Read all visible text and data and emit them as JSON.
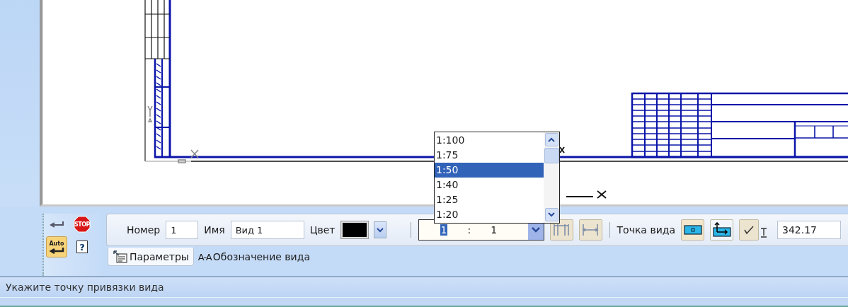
{
  "commands": {
    "stop_label": "STOP",
    "auto_label": "Auto",
    "help_label": "?"
  },
  "parameters": {
    "number_label": "Номер",
    "number_value": "1",
    "name_label": "Имя",
    "name_value": "Вид 1",
    "color_label": "Цвет",
    "color": "#000000",
    "scale": {
      "numerator": "1",
      "separator": ":",
      "denominator": "1",
      "expanded": true
    },
    "scale_options": [
      {
        "label": "1:100",
        "selected": false
      },
      {
        "label": "1:75",
        "selected": false
      },
      {
        "label": "1:50",
        "selected": true
      },
      {
        "label": "1:40",
        "selected": false
      },
      {
        "label": "1:25",
        "selected": false
      },
      {
        "label": "1:20",
        "selected": false
      }
    ],
    "view_point_label": "Точка вида",
    "coordinate_value": "342.17"
  },
  "tabs": [
    {
      "label": "Параметры",
      "selected": true
    },
    {
      "label": "Обозначение вида",
      "icon_text": "A-A",
      "selected": false
    }
  ],
  "status_bar": "Укажите точку привязки вида"
}
